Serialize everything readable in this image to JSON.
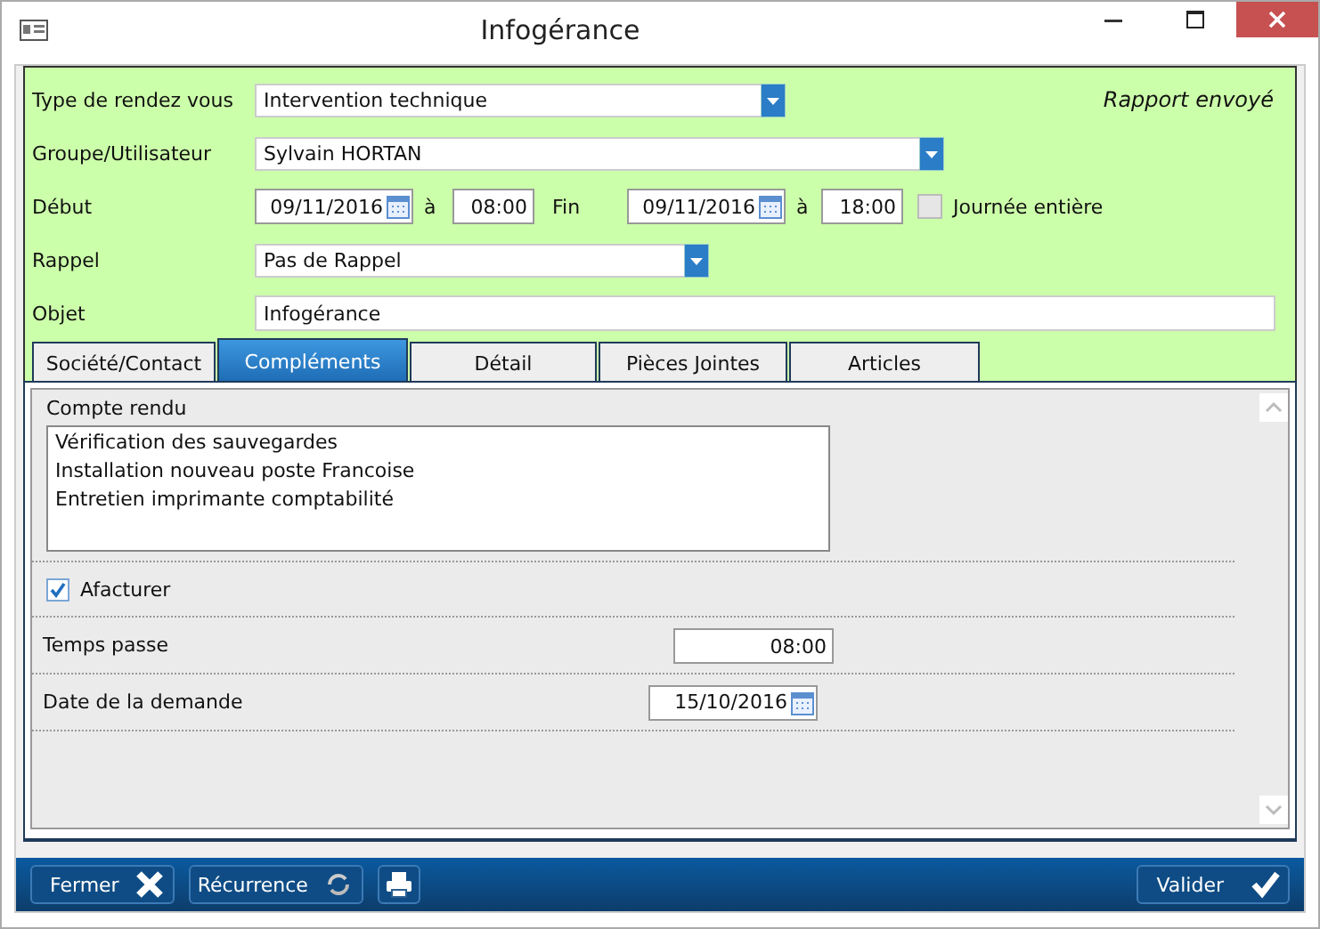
{
  "window": {
    "title": "Infogérance"
  },
  "status": "Rapport envoyé",
  "form": {
    "type": {
      "label": "Type de rendez vous",
      "value": "Intervention technique"
    },
    "group": {
      "label": "Groupe/Utilisateur",
      "value": "Sylvain HORTAN"
    },
    "start": {
      "label": "Début",
      "date": "09/11/2016",
      "at": "à",
      "time": "08:00"
    },
    "end": {
      "label": "Fin",
      "date": "09/11/2016",
      "at": "à",
      "time": "18:00"
    },
    "all_day": {
      "label": "Journée entière",
      "checked": false
    },
    "reminder": {
      "label": "Rappel",
      "value": "Pas de Rappel"
    },
    "subject": {
      "label": "Objet",
      "value": "Infogérance"
    }
  },
  "tabs": [
    {
      "label": "Société/Contact",
      "selected": false
    },
    {
      "label": "Compléments",
      "selected": true
    },
    {
      "label": "Détail",
      "selected": false
    },
    {
      "label": "Pièces Jointes",
      "selected": false
    },
    {
      "label": "Articles",
      "selected": false
    }
  ],
  "panel": {
    "report": {
      "label": "Compte rendu",
      "lines": [
        "Vérification des sauvegardes",
        "Installation nouveau poste Francoise",
        "Entretien imprimante comptabilité"
      ]
    },
    "invoice": {
      "label": "Afacturer",
      "checked": true
    },
    "time_spent": {
      "label": "Temps passe",
      "value": "08:00"
    },
    "request_date": {
      "label": "Date de la demande",
      "value": "15/10/2016"
    }
  },
  "buttons": [
    {
      "kind": "close",
      "label": "Fermer"
    },
    {
      "kind": "recurrence",
      "label": "Récurrence"
    },
    {
      "kind": "print"
    },
    {
      "kind": "validate",
      "label": "Valider"
    }
  ]
}
